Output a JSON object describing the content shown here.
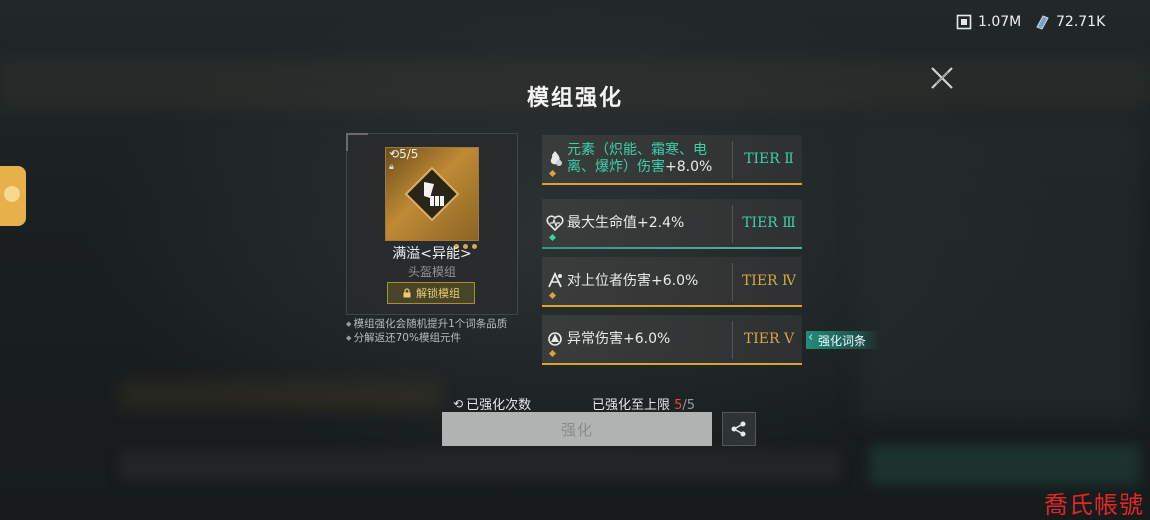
{
  "currency": [
    {
      "icon": "energy-chip-icon",
      "value": "1.07M"
    },
    {
      "icon": "crystal-shard-icon",
      "value": "72.71K"
    }
  ],
  "title": "模组强化",
  "module": {
    "count": "5/5",
    "name": "满溢<异能>",
    "type": "头盔模组",
    "unlock_label": "解锁模组"
  },
  "notes": [
    "模组强化会随机提升1个词条品质",
    "分解返还70%模组元件"
  ],
  "affixes": [
    {
      "label_main": "元素（炽能、霜寒、电离、爆炸）伤害",
      "value": "+8.0%",
      "tier": "TIER Ⅱ",
      "icon": "element-flame-icon"
    },
    {
      "label": "最大生命值+2.4%",
      "tier": "TIER Ⅲ",
      "icon": "heart-pulse-icon"
    },
    {
      "label": "对上位者伤害+6.0%",
      "tier": "TIER Ⅳ",
      "icon": "superior-target-icon"
    },
    {
      "label": "异常伤害+6.0%",
      "tier": "TIER Ⅴ",
      "icon": "anomaly-icon"
    }
  ],
  "enhance_tag": "强化词条",
  "enhance_count_label": "已强化次数",
  "limit": {
    "label": "已强化至上限 ",
    "current": "5",
    "max": "/5"
  },
  "enhance_button": "强化",
  "watermark": "喬氏帳號",
  "colors": {
    "gold": "#d9a23a",
    "teal": "#3fcfa6",
    "red": "#e0474a"
  }
}
